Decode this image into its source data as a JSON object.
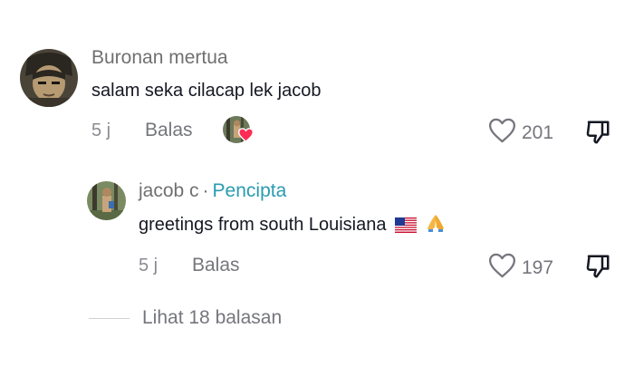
{
  "comments": [
    {
      "username": "Buronan mertua",
      "text": "salam seka cilacap lek jacob",
      "time": "5 j",
      "reply_label": "Balas",
      "likes": "201",
      "creator_liked": true
    }
  ],
  "reply": {
    "username": "jacob c",
    "separator": "·",
    "creator_label": "Pencipta",
    "text": "greetings from south Louisiana",
    "emoji": [
      "us-flag-emoji",
      "folded-hands-emoji"
    ],
    "time": "5 j",
    "reply_label": "Balas",
    "likes": "197"
  },
  "view_replies_label": "Lihat 18 balasan",
  "colors": {
    "creator": "#2a9bb0",
    "liked_heart": "#fe2c55"
  }
}
